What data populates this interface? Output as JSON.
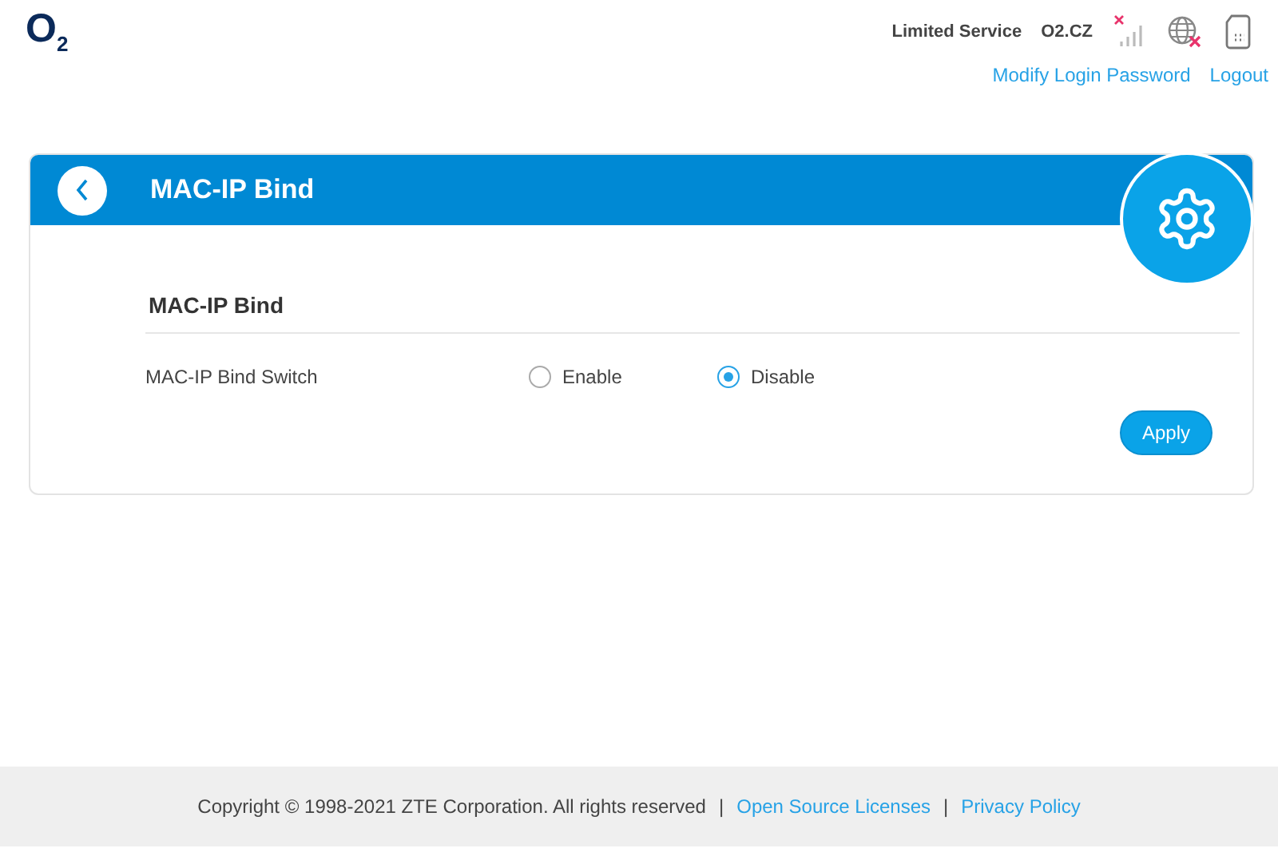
{
  "logo": "O$_{2}$",
  "status": {
    "service": "Limited Service",
    "operator": "O2.CZ"
  },
  "header_links": [
    "Modify Login Password",
    "Logout"
  ],
  "page": {
    "title": "MAC-IP Bind",
    "section_title": "MAC-IP Bind",
    "field_label": "MAC-IP Bind Switch",
    "options": [
      {
        "label": "Enable",
        "selected": false
      },
      {
        "label": "Disable",
        "selected": true
      }
    ],
    "apply": "Apply"
  },
  "footer": {
    "copyright": "Copyright © 1998-2021 ZTE Corporation. All rights reserved",
    "separators": [
      "|",
      "|"
    ],
    "links": [
      "Open Source Licenses",
      "Privacy Policy"
    ]
  }
}
